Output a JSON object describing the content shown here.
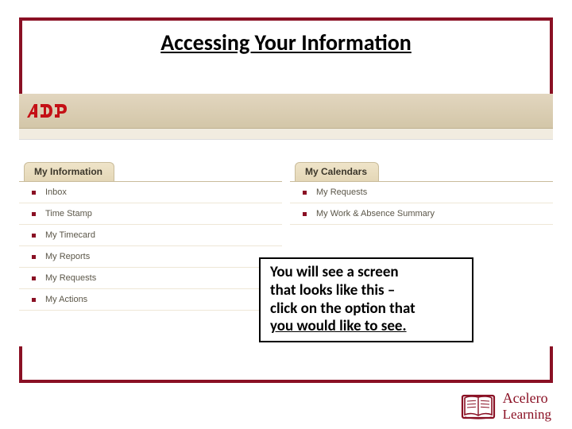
{
  "title": "Accessing Your Information",
  "panels": {
    "left": {
      "header": "My Information",
      "items": [
        "Inbox",
        "Time Stamp",
        "My Timecard",
        "My Reports",
        "My Requests",
        "My Actions"
      ]
    },
    "right": {
      "header": "My Calendars",
      "items": [
        "My Requests",
        "My Work & Absence Summary"
      ]
    }
  },
  "callout": {
    "line1": "You will see a screen",
    "line2": "that looks like this –",
    "line3": "click on the option that",
    "line4": "you would like to see."
  },
  "footer": {
    "brand1": "Acelero",
    "brand2": "Learning"
  },
  "logo_alt": "ADP"
}
